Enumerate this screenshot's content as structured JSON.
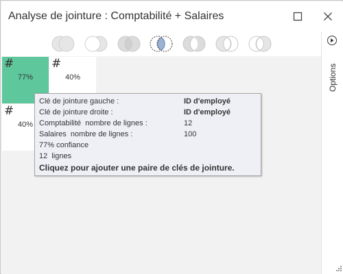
{
  "window": {
    "title": "Analyse de jointure : Comptabilité + Salaires"
  },
  "join_types": [
    {
      "name": "none",
      "selected": false
    },
    {
      "name": "right",
      "selected": false
    },
    {
      "name": "full",
      "selected": false
    },
    {
      "name": "inner",
      "selected": true
    },
    {
      "name": "outer",
      "selected": false
    },
    {
      "name": "left-exclusive",
      "selected": false
    },
    {
      "name": "right-exclusive",
      "selected": false
    }
  ],
  "grid": {
    "cells": [
      {
        "symbol": "#",
        "percent": "77%",
        "color": "#5ec79b"
      },
      {
        "symbol": "#",
        "percent": "40%",
        "color": "#ffffff"
      },
      {
        "symbol": "#",
        "percent": "40%",
        "color": "#ffffff"
      }
    ]
  },
  "options": {
    "label": "Options"
  },
  "tooltip": {
    "left_key_label": "Clé de jointure gauche :",
    "left_key_value": "ID d'employé",
    "right_key_label": "Clé de jointure droite :",
    "right_key_value": "ID d'employé",
    "comptabilite_rows_label": "Comptabilité  nombre de lignes :",
    "comptabilite_rows_value": "12",
    "salaires_rows_label": "Salaires  nombre de lignes :",
    "salaires_rows_value": "100",
    "confidence": "77% confiance",
    "rows": "12  lignes",
    "action": "Cliquez pour ajouter une paire de clés de jointure."
  },
  "colors": {
    "match_high": "#5ec79b",
    "selected_join_fill": "#9ab3d5",
    "tooltip_bg": "#eef0f6"
  }
}
